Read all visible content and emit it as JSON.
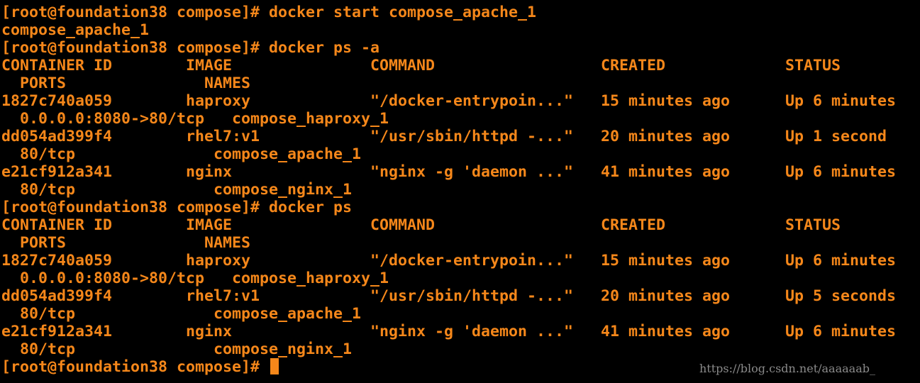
{
  "terminal": {
    "foreground": "#f5871a",
    "background": "#000000",
    "lines": [
      "[root@foundation38 compose]# docker start compose_apache_1",
      "compose_apache_1",
      "[root@foundation38 compose]# docker ps -a",
      "CONTAINER ID        IMAGE               COMMAND                  CREATED             STATUS",
      "  PORTS               NAMES",
      "1827c740a059        haproxy             \"/docker-entrypoin...\"   15 minutes ago      Up 6 minutes",
      "  0.0.0.0:8080->80/tcp   compose_haproxy_1",
      "dd054ad399f4        rhel7:v1            \"/usr/sbin/httpd -...\"   20 minutes ago      Up 1 second",
      "  80/tcp               compose_apache_1",
      "e21cf912a341        nginx               \"nginx -g 'daemon ...\"   41 minutes ago      Up 6 minutes",
      "  80/tcp               compose_nginx_1",
      "[root@foundation38 compose]# docker ps",
      "CONTAINER ID        IMAGE               COMMAND                  CREATED             STATUS",
      "  PORTS               NAMES",
      "1827c740a059        haproxy             \"/docker-entrypoin...\"   15 minutes ago      Up 6 minutes",
      "  0.0.0.0:8080->80/tcp   compose_haproxy_1",
      "dd054ad399f4        rhel7:v1            \"/usr/sbin/httpd -...\"   20 minutes ago      Up 5 seconds",
      "  80/tcp               compose_apache_1",
      "e21cf912a341        nginx               \"nginx -g 'daemon ...\"   41 minutes ago      Up 6 minutes",
      "  80/tcp               compose_nginx_1"
    ],
    "prompt": "[root@foundation38 compose]# "
  },
  "watermark": "https://blog.csdn.net/aaaaaab_"
}
